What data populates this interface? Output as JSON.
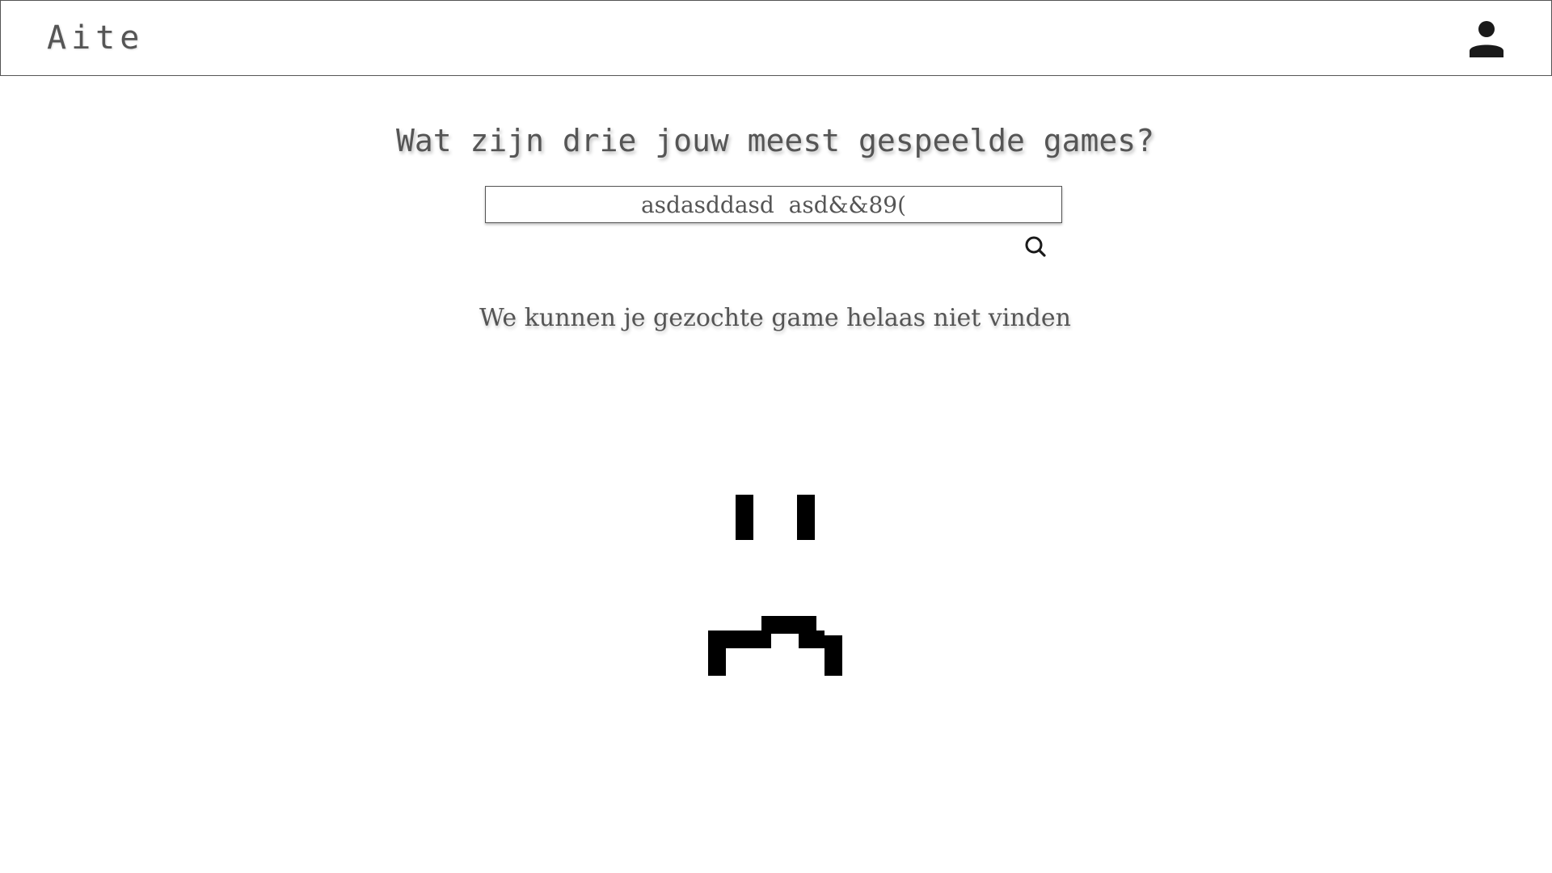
{
  "header": {
    "brand": "Aite",
    "account_icon": "person-icon"
  },
  "main": {
    "question": "Wat zijn drie jouw meest gespeelde games?",
    "search": {
      "value": "asdasddasd  asd&&89(",
      "icon": "search-icon"
    },
    "empty_message": "We kunnen je gezochte game helaas niet vinden",
    "illustration_icon": "sad-face-icon"
  },
  "colors": {
    "text": "#555555",
    "border": "#555555",
    "icon": "#1a1a1a",
    "face": "#000000"
  }
}
